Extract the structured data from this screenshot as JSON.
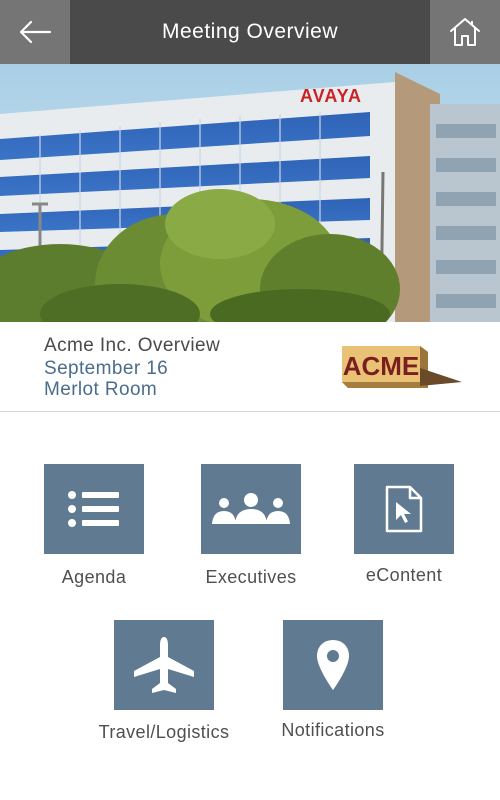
{
  "header": {
    "title": "Meeting Overview",
    "back_icon": "back-arrow-icon",
    "home_icon": "home-icon"
  },
  "hero": {
    "building_sign": "AVAYA"
  },
  "meeting": {
    "name": "Acme Inc. Overview",
    "date": "September 16",
    "room": "Merlot Room",
    "logo_text": "ACME"
  },
  "menu": {
    "agenda": "Agenda",
    "executives": "Executives",
    "econtent": "eContent",
    "travel": "Travel/Logistics",
    "notifications": "Notifications"
  },
  "colors": {
    "header_bg": "#4a4a4a",
    "header_button_bg": "#757575",
    "tile_bg": "#607a91",
    "accent_text": "#4a6d8c"
  }
}
